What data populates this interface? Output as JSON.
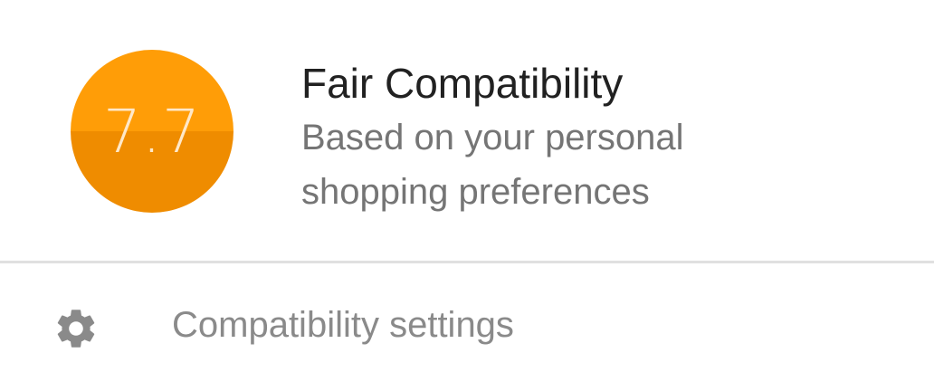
{
  "compatibility": {
    "score": "7.7",
    "title": "Fair Compatibility",
    "description": "Based on your personal shopping preferences",
    "badge_colors": {
      "top": "#ff9d07",
      "bottom": "#ef8c00",
      "text": "#ffe8c8"
    }
  },
  "settings": {
    "icon": "gear-icon",
    "label": "Compatibility settings"
  }
}
